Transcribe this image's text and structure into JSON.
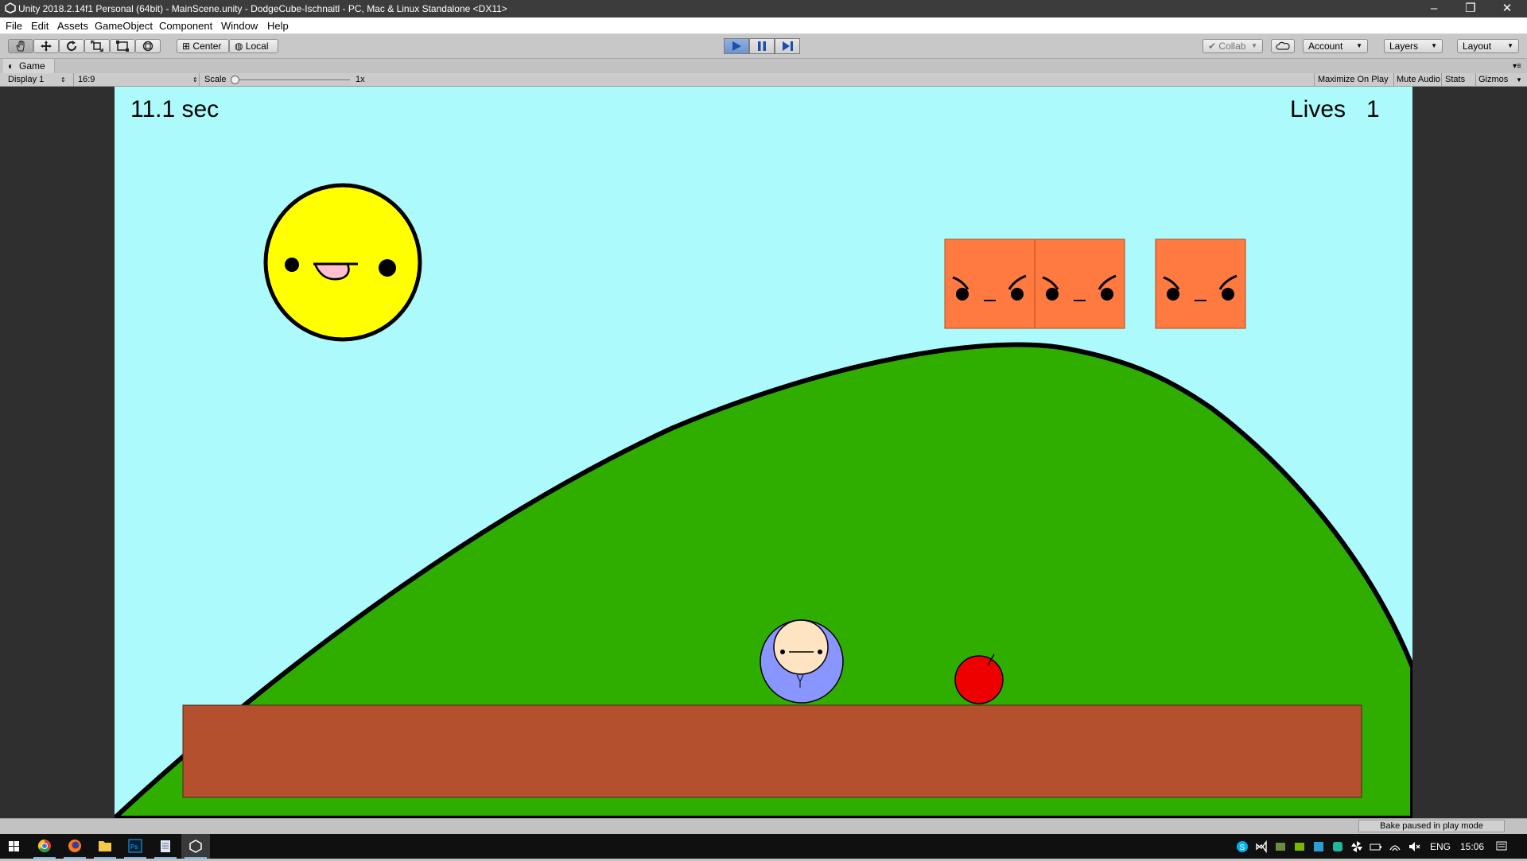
{
  "window": {
    "title": "Unity 2018.2.14f1 Personal (64bit) - MainScene.unity - DodgeCube-Ischnaitl - PC, Mac & Linux Standalone <DX11>",
    "minimize": "–",
    "restore": "❐",
    "close": "✕"
  },
  "menu": [
    "File",
    "Edit",
    "Assets",
    "GameObject",
    "Component",
    "Window",
    "Help"
  ],
  "toolbar": {
    "tools": [
      "hand-icon",
      "move-icon",
      "rotate-icon",
      "scale-icon",
      "rect-icon",
      "transform-icon"
    ],
    "pivot_mode": "Center",
    "pivot_rotation": "Local",
    "play_state": "playing",
    "collab": "Collab",
    "account": "Account",
    "layers": "Layers",
    "layout": "Layout"
  },
  "game_view": {
    "tab_title": "Game",
    "display": "Display 1",
    "aspect": "16:9",
    "scale_label": "Scale",
    "scale_value": "1x",
    "maximize_on_play": "Maximize On Play",
    "mute_audio": "Mute Audio",
    "stats": "Stats",
    "gizmos": "Gizmos"
  },
  "hud": {
    "timer": "11.1 sec",
    "lives_label": "Lives",
    "lives_value": "1"
  },
  "status": {
    "bake": "Bake paused in play mode"
  },
  "taskbar": {
    "language": "ENG",
    "time": "15:06"
  },
  "colors": {
    "sky": "#adfafc",
    "hill": "#2fae00",
    "ground": "#b5502e",
    "sun": "#ffff00",
    "cube": "#ff7a40",
    "player": "#8a96ff",
    "apple": "#ee0000"
  }
}
